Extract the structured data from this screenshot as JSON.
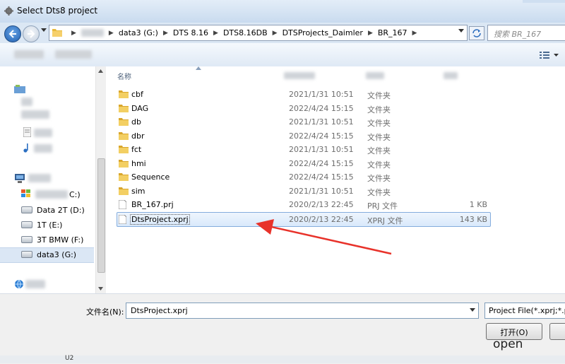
{
  "window": {
    "title": "Select Dts8 project"
  },
  "address": {
    "crumbs": [
      "data3 (G:)",
      "DTS 8.16",
      "DTS8.16DB",
      "DTSProjects_Daimler",
      "BR_167"
    ]
  },
  "search": {
    "placeholder": "搜索 BR_167"
  },
  "columns": {
    "name": "名称"
  },
  "nav": {
    "drives": [
      "Data 2T (D:)",
      "1T (E:)",
      "3T BMW (F:)",
      "data3 (G:)"
    ],
    "partial_drive": "C:)"
  },
  "files": [
    {
      "name": "cbf",
      "date": "2021/1/31 10:51",
      "type": "文件夹",
      "size": "",
      "kind": "folder"
    },
    {
      "name": "DAG",
      "date": "2022/4/24 15:15",
      "type": "文件夹",
      "size": "",
      "kind": "folder"
    },
    {
      "name": "db",
      "date": "2021/1/31 10:51",
      "type": "文件夹",
      "size": "",
      "kind": "folder"
    },
    {
      "name": "dbr",
      "date": "2022/4/24 15:15",
      "type": "文件夹",
      "size": "",
      "kind": "folder"
    },
    {
      "name": "fct",
      "date": "2021/1/31 10:51",
      "type": "文件夹",
      "size": "",
      "kind": "folder"
    },
    {
      "name": "hmi",
      "date": "2022/4/24 15:15",
      "type": "文件夹",
      "size": "",
      "kind": "folder"
    },
    {
      "name": "Sequence",
      "date": "2022/4/24 15:15",
      "type": "文件夹",
      "size": "",
      "kind": "folder"
    },
    {
      "name": "sim",
      "date": "2021/1/31 10:51",
      "type": "文件夹",
      "size": "",
      "kind": "folder"
    },
    {
      "name": "BR_167.prj",
      "date": "2020/2/13 22:45",
      "type": "PRJ 文件",
      "size": "1 KB",
      "kind": "file"
    },
    {
      "name": "DtsProject.xprj",
      "date": "2020/2/13 22:45",
      "type": "XPRJ 文件",
      "size": "143 KB",
      "kind": "file"
    }
  ],
  "bottom": {
    "filename_label": "文件名(N):",
    "filename_value": "DtsProject.xprj",
    "filetype_value": "Project File(*.xprj;*.prj)",
    "open_label": "打开(O)",
    "open_annotation": "open"
  },
  "status": {
    "text": "U2"
  },
  "colors": {
    "arrow": "#e8322a",
    "selection": "#d9e9fb"
  }
}
